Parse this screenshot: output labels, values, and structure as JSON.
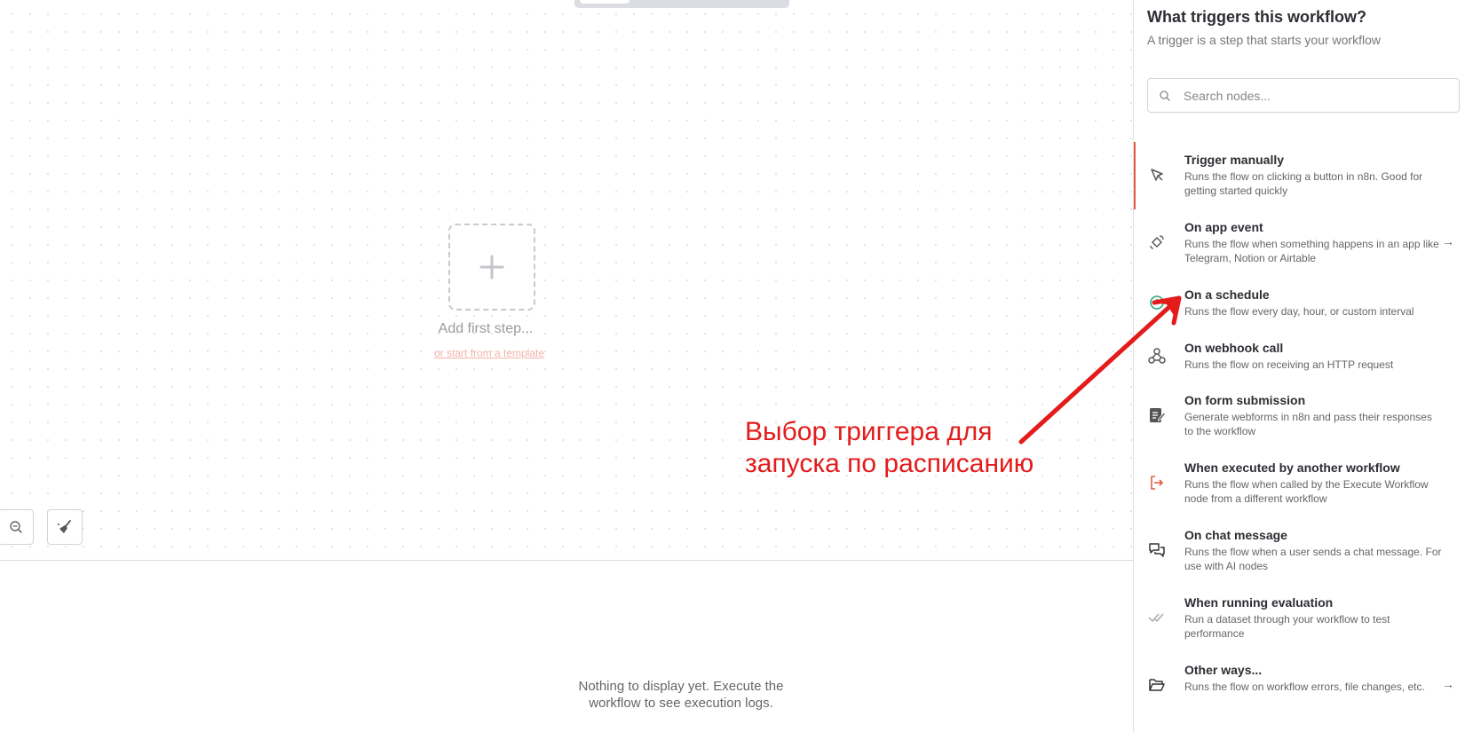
{
  "canvas": {
    "add_first_step": "Add first step...",
    "template_link": "or start from a template"
  },
  "logs": {
    "empty_line1": "Nothing to display yet. Execute the",
    "empty_line2": "workflow to see execution logs."
  },
  "annotation": {
    "line1": "Выбор триггера для",
    "line2": "запуска по расписанию",
    "color": "#e31b1b"
  },
  "panel": {
    "title": "What triggers this workflow?",
    "subtitle": "A trigger is a step that starts your workflow",
    "search_placeholder": "Search nodes...",
    "items": [
      {
        "icon": "cursor-icon",
        "name": "Trigger manually",
        "desc": "Runs the flow on clicking a button in n8n. Good for getting started quickly"
      },
      {
        "icon": "satellite-icon",
        "name": "On app event",
        "desc": "Runs the flow when something happens in an app like Telegram, Notion or Airtable"
      },
      {
        "icon": "clock-icon",
        "name": "On a schedule",
        "desc": "Runs the flow every day, hour, or custom interval"
      },
      {
        "icon": "webhook-icon",
        "name": "On webhook call",
        "desc": "Runs the flow on receiving an HTTP request"
      },
      {
        "icon": "form-icon",
        "name": "On form submission",
        "desc": "Generate webforms in n8n and pass their responses to the workflow"
      },
      {
        "icon": "sign-in-icon",
        "name": "When executed by another workflow",
        "desc": "Runs the flow when called by the Execute Workflow node from a different workflow"
      },
      {
        "icon": "chat-icon",
        "name": "On chat message",
        "desc": "Runs the flow when a user sends a chat message. For use with AI nodes"
      },
      {
        "icon": "double-check-icon",
        "name": "When running evaluation",
        "desc": "Run a dataset through your workflow to test performance"
      },
      {
        "icon": "folder-open-icon",
        "name": "Other ways...",
        "desc": "Runs the flow on workflow errors, file changes, etc."
      }
    ],
    "chevron": "→",
    "accent": "#e35d45"
  }
}
